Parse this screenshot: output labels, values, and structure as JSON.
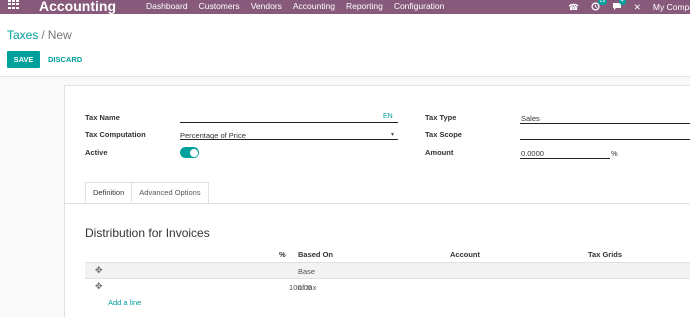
{
  "navbar": {
    "brand": "Accounting",
    "menu": [
      "Dashboard",
      "Customers",
      "Vendors",
      "Accounting",
      "Reporting",
      "Configuration"
    ],
    "phone_icon": "☎",
    "activity_badge": "29",
    "messages_badge": "4",
    "close_icon": "✕",
    "company": "My Compa"
  },
  "breadcrumb": {
    "parent": "Taxes",
    "separator": "/",
    "current": "New"
  },
  "buttons": {
    "save": "SAVE",
    "discard": "DISCARD"
  },
  "form": {
    "tax_name_label": "Tax Name",
    "tax_name_lang": "EN",
    "tax_computation_label": "Tax Computation",
    "tax_computation_value": "Percentage of Price",
    "active_label": "Active",
    "active_on": true,
    "tax_type_label": "Tax Type",
    "tax_type_value": "Sales",
    "tax_scope_label": "Tax Scope",
    "amount_label": "Amount",
    "amount_value": "0.0000",
    "amount_unit": "%"
  },
  "tabs": [
    "Definition",
    "Advanced Options"
  ],
  "section_title": "Distribution for Invoices",
  "table": {
    "headers": {
      "percent": "%",
      "based_on": "Based On",
      "account": "Account",
      "tax_grids": "Tax Grids"
    },
    "rows": [
      {
        "percent": "",
        "based_on": "Base"
      },
      {
        "percent": "100.00",
        "based_on": "of tax"
      }
    ],
    "add_line": "Add a line"
  },
  "colors": {
    "navbar": "#875a7b",
    "accent": "#00a09d"
  }
}
